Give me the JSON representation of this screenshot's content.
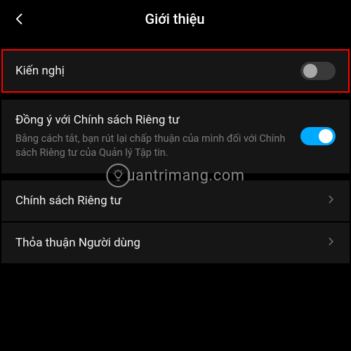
{
  "header": {
    "title": "Giới thiệu"
  },
  "rows": {
    "recommend": {
      "label": "Kiến nghị",
      "toggle_state": "off"
    },
    "privacy_consent": {
      "label": "Đồng ý với Chính sách Riêng tư",
      "desc": "Bằng cách tắt, bạn rút lại chấp thuận của mình đối với Chính sách Riêng tư của Quản lý Tập tin.",
      "toggle_state": "on"
    },
    "privacy_policy": {
      "label": "Chính sách Riêng tư"
    },
    "user_agreement": {
      "label": "Thỏa thuận Người dùng"
    }
  },
  "watermark": {
    "text": "uantrimang.com"
  },
  "colors": {
    "accent": "#00aaff",
    "highlight": "#ff0000"
  }
}
